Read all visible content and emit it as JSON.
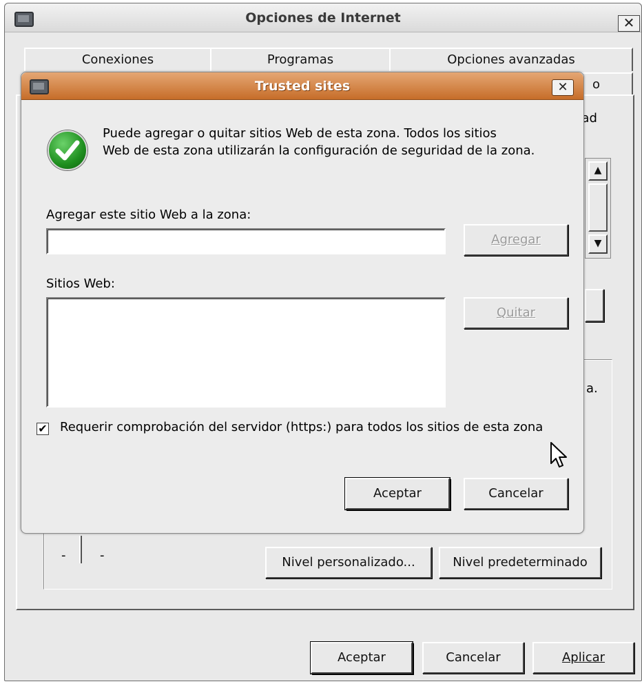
{
  "outer_window": {
    "title": "Opciones de Internet",
    "close_glyph": "✕",
    "tabs_row1": [
      "Conexiones",
      "Programas",
      "Opciones avanzadas"
    ],
    "tab_fragment": "o",
    "panel_fragments": {
      "dad": "dad",
      "a_dot": "a."
    },
    "slider_marks": [
      "-",
      "-"
    ],
    "nivel_personalizado_label": "Nivel personalizado...",
    "nivel_predeterminado_label": "Nivel predeterminado",
    "aceptar_label": "Aceptar",
    "cancelar_label": "Cancelar",
    "aplicar_label": "Aplicar"
  },
  "dialog": {
    "title": "Trusted sites",
    "close_glyph": "✕",
    "info_line1": "Puede agregar o quitar sitios Web de esta zona.  Todos los sitios",
    "info_line2": "Web de esta zona utilizarán la configuración de seguridad de la zona.",
    "add_label": "Agregar este sitio Web a la zona:",
    "add_input_value": "",
    "add_button_label": "Agregar",
    "sites_label": "Sitios Web:",
    "sites_list": [],
    "remove_button_label": "Quitar",
    "https_checkbox_checked": true,
    "https_checkbox_label": "Requerir comprobación del servidor (https:) para todos los sitios de esta zona",
    "aceptar_label": "Aceptar",
    "cancelar_label": "Cancelar"
  },
  "colors": {
    "dialog_titlebar": "#c66d29",
    "window_bg": "#e9e9e9",
    "check_icon": "#1f8f1f"
  }
}
